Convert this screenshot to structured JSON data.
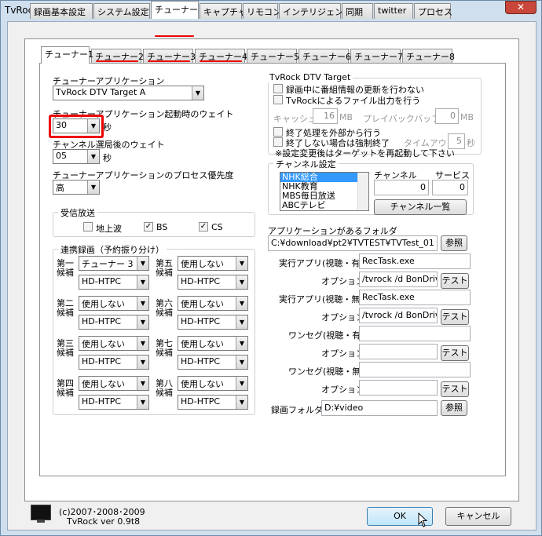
{
  "window": {
    "title": "TvRock設定",
    "close": "✕"
  },
  "tabs": [
    "録画基本設定",
    "システム設定",
    "チューナー",
    "キャプチャ",
    "リモコン",
    "インテリジェント",
    "同期",
    "twitter",
    "プロセス"
  ],
  "subtabs": [
    "チューナー1",
    "チューナー2",
    "チューナー3",
    "チューナー4",
    "チューナー5",
    "チューナー6",
    "チューナー7",
    "チューナー8"
  ],
  "left": {
    "app_label": "チューナーアプリケーション",
    "app_value": "TvRock DTV Target A",
    "wait_label": "チューナーアプリケーション起動時のウェイト",
    "wait_value": "30",
    "wait_unit": "秒",
    "chwait_label": "チャンネル選局後のウェイト",
    "chwait_value": "05",
    "chwait_unit": "秒",
    "priority_label": "チューナーアプリケーションのプロセス優先度",
    "priority_value": "高",
    "recv_title": "受信放送",
    "recv": [
      {
        "label": "地上波",
        "checked": ""
      },
      {
        "label": "BS",
        "checked": "✓"
      },
      {
        "label": "CS",
        "checked": "✓"
      }
    ],
    "link_title": "連携録画（予約振り分け）",
    "candidates": [
      {
        "l1": "第一",
        "l2": "候補",
        "a": "チューナー 3",
        "b": "HD-HTPC"
      },
      {
        "l1": "第二",
        "l2": "候補",
        "a": "使用しない",
        "b": "HD-HTPC"
      },
      {
        "l1": "第三",
        "l2": "候補",
        "a": "使用しない",
        "b": "HD-HTPC"
      },
      {
        "l1": "第四",
        "l2": "候補",
        "a": "使用しない",
        "b": "HD-HTPC"
      },
      {
        "l1": "第五",
        "l2": "候補",
        "a": "使用しない",
        "b": "HD-HTPC"
      },
      {
        "l1": "第六",
        "l2": "候補",
        "a": "使用しない",
        "b": "HD-HTPC"
      },
      {
        "l1": "第七",
        "l2": "候補",
        "a": "使用しない",
        "b": "HD-HTPC"
      },
      {
        "l1": "第八",
        "l2": "候補",
        "a": "使用しない",
        "b": "HD-HTPC"
      }
    ]
  },
  "right": {
    "dtv_title": "TvRock DTV Target",
    "chk1": "録画中に番組情報の更新を行わない",
    "chk2": "TvRockによるファイル出力を行う",
    "cache_label": "キャッシュ",
    "cache_value": "16",
    "cache_unit": "MB",
    "play_label": "プレイバックバッファ",
    "play_value": "0",
    "play_unit": "MB",
    "chk3": "終了処理を外部から行う",
    "chk4": "終了しない場合は強制終了",
    "timeout_label": "タイムアウト",
    "timeout_value": "5",
    "timeout_unit": "秒",
    "note": "※設定変更後はターゲットを再起動して下さい",
    "ch_title": "チャンネル設定",
    "channels": [
      "NHK総合",
      "NHK教育",
      "MBS毎日放送",
      "ABCテレビ"
    ],
    "ch_label": "チャンネル",
    "ch_value": "0",
    "svc_label": "サービス",
    "svc_value": "0",
    "ch_list_btn": "チャンネル一覧",
    "folder_label": "アプリケーションがあるフォルダ",
    "folder_value": "C:¥download¥pt2¥TVTEST¥TVTest_01",
    "browse": "参照",
    "exec1_label": "実行アプリ(視聴・有)",
    "exec1_value": "RecTask.exe",
    "opt_label": "オプション",
    "opt1_value": "/tvrock /d BonDriv",
    "test": "テスト",
    "exec2_label": "実行アプリ(視聴・無)",
    "exec2_value": "RecTask.exe",
    "opt2_value": "/tvrock /d BonDriv",
    "oneseg1_label": "ワンセグ(視聴・有)",
    "oneseg2_label": "ワンセグ(視聴・無)",
    "recfolder_label": "録画フォルダ",
    "recfolder_value": "D:¥video"
  },
  "footer": {
    "copyright": "(c)2007･2008･2009",
    "version": "TvRock ver 0.9t8",
    "ok": "OK",
    "cancel": "キャンセル"
  }
}
